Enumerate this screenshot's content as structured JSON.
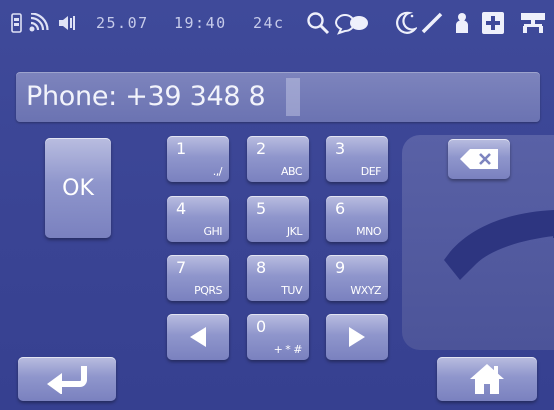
{
  "status_bar": {
    "date": "25.07",
    "time": "19:40",
    "temperature": "24c"
  },
  "phone_field": {
    "label_value": "Phone: +39 348 8"
  },
  "ok_button": {
    "label": "OK"
  },
  "keypad": [
    {
      "num": "1",
      "letters": ".,/"
    },
    {
      "num": "2",
      "letters": "ABC"
    },
    {
      "num": "3",
      "letters": "DEF"
    },
    {
      "num": "4",
      "letters": "GHI"
    },
    {
      "num": "5",
      "letters": "JKL"
    },
    {
      "num": "6",
      "letters": "MNO"
    },
    {
      "num": "7",
      "letters": "PQRS"
    },
    {
      "num": "8",
      "letters": "TUV"
    },
    {
      "num": "9",
      "letters": "WXYZ"
    },
    {
      "num": "0",
      "letters": "+ * #"
    }
  ],
  "icons": {
    "sim": "sim-card-icon",
    "signal": "wireless-signal-icon",
    "speaker": "speaker-icon",
    "search": "search-icon",
    "chat": "chat-icon",
    "night": "moon-icon",
    "pen": "pen-icon",
    "user": "person-icon",
    "add": "plus-icon",
    "network": "network-icon",
    "backspace": "backspace-icon",
    "handset": "phone-handset-icon",
    "left": "arrow-left-icon",
    "right": "arrow-right-icon",
    "enter": "enter-return-icon",
    "home": "home-icon"
  },
  "colors": {
    "background": "#3a4494",
    "button": "#8f96cc",
    "field": "#737ab6",
    "text": "#ffffff"
  }
}
